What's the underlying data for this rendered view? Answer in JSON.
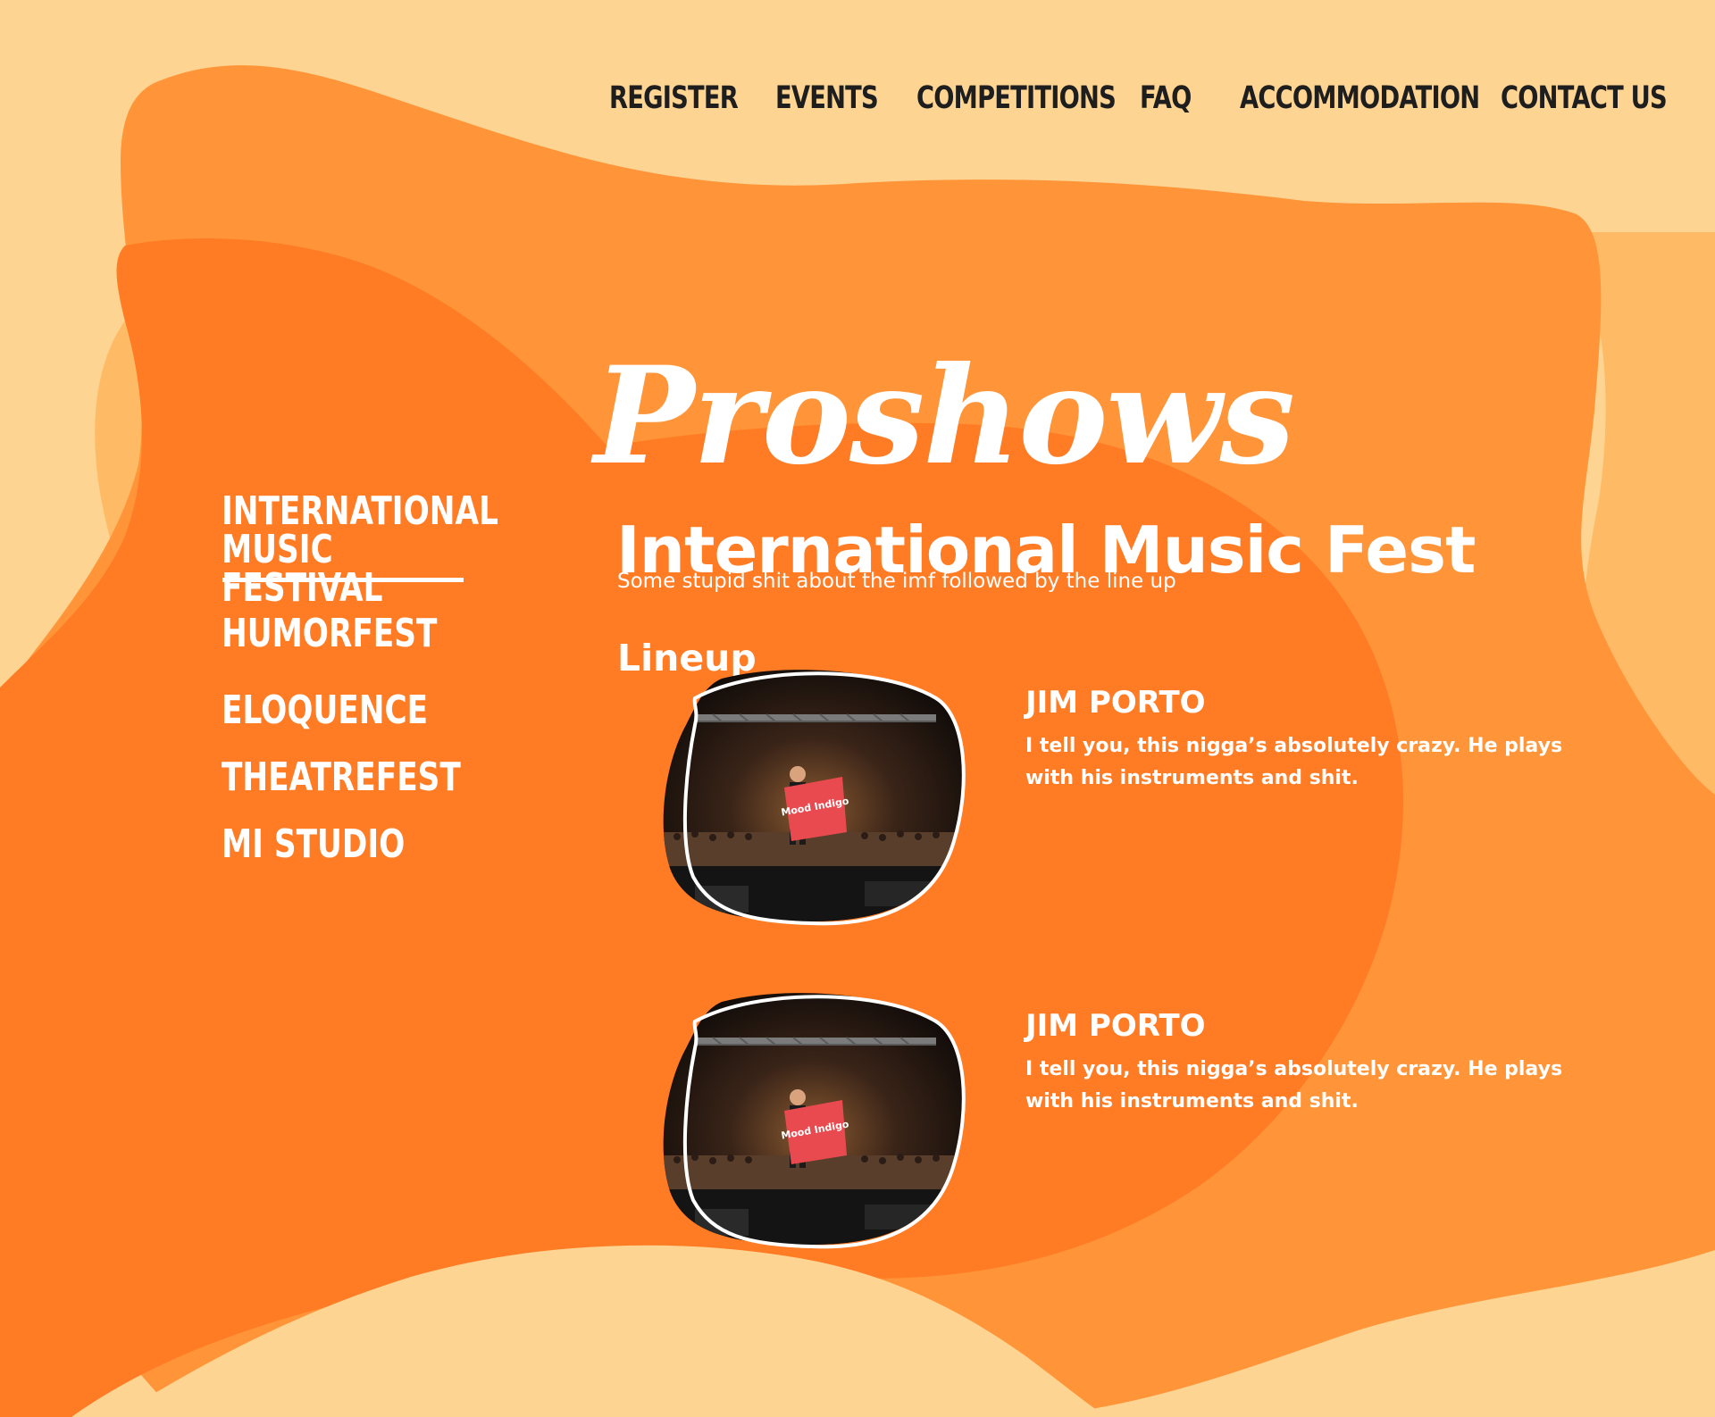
{
  "nav": {
    "items": [
      {
        "label": "REGISTER"
      },
      {
        "label": "EVENTS"
      },
      {
        "label": "COMPETITIONS"
      },
      {
        "label": "FAQ"
      },
      {
        "label": "ACCOMMODATION"
      },
      {
        "label": "CONTACT US"
      }
    ]
  },
  "page": {
    "script_title": "Proshows"
  },
  "sidebar": {
    "items": [
      {
        "label": "INTERNATIONAL MUSIC FESTIVAL",
        "active": true
      },
      {
        "label": "HUMORFEST"
      },
      {
        "label": "ELOQUENCE"
      },
      {
        "label": "THEATREFEST"
      },
      {
        "label": "MI STUDIO"
      }
    ]
  },
  "main": {
    "title": "International Music Fest",
    "subtitle": "Some stupid shit about the imf followed by the line up",
    "lineup_heading": "Lineup",
    "artists": [
      {
        "name": "JIM PORTO",
        "description": "I tell you, this nigga’s absolutely crazy. He plays with his instruments and shit.",
        "flag_text": "Mood Indigo"
      },
      {
        "name": "JIM PORTO",
        "description": "I tell you, this nigga’s absolutely crazy. He plays with his instruments and shit.",
        "flag_text": "Mood Indigo"
      }
    ]
  },
  "colors": {
    "background": "#FED492",
    "blob_light": "#FF9538",
    "blob_dark": "#FF7B24",
    "blob_peach": "#FFBA66",
    "text_nav": "#1E1E1E",
    "text_light": "#FFFFFF"
  }
}
